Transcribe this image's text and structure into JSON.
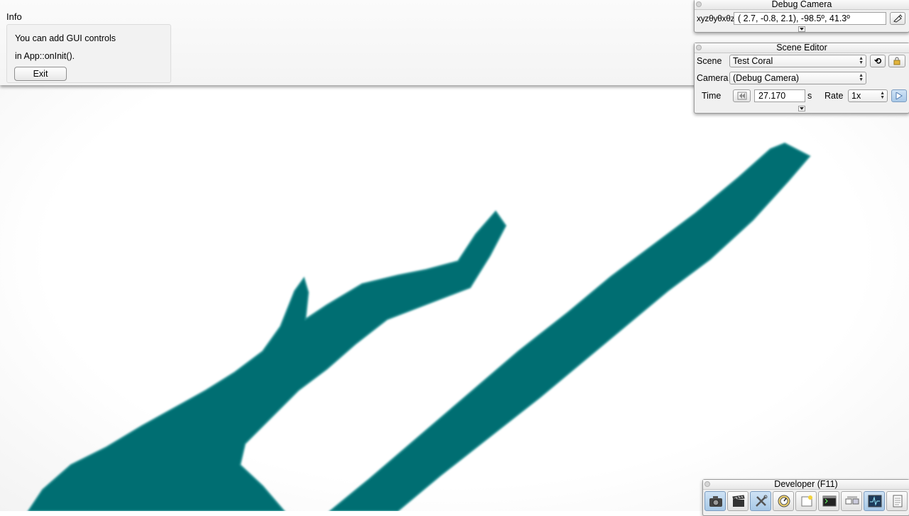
{
  "info_window": {
    "title": "Info",
    "line1": "You can add GUI controls",
    "line2": "in App::onInit().",
    "exit_label": "Exit"
  },
  "debug_camera": {
    "title": "Debug Camera",
    "coord_label": "xyzθyθxθz",
    "coord_value": "(  2.7,  -0.8,   2.1), -98.5º,  41.3º"
  },
  "scene_editor": {
    "title": "Scene Editor",
    "scene_label": "Scene",
    "scene_value": "Test Coral",
    "reload_label": "⟲",
    "camera_label": "Camera",
    "camera_value": "(Debug Camera)",
    "time_label": "Time",
    "time_value": "27.170",
    "time_unit": "s",
    "rate_label": "Rate",
    "rate_value": "1x"
  },
  "developer": {
    "title": "Developer (F11)",
    "tools": [
      "camera-icon",
      "film-clapper-icon",
      "tools-icon",
      "speedometer-icon",
      "new-window-icon",
      "console-icon",
      "scene-graph-icon",
      "profiler-icon",
      "document-icon"
    ]
  },
  "colors": {
    "coral": "#056e72",
    "accent_blue": "#a9c9e8"
  }
}
